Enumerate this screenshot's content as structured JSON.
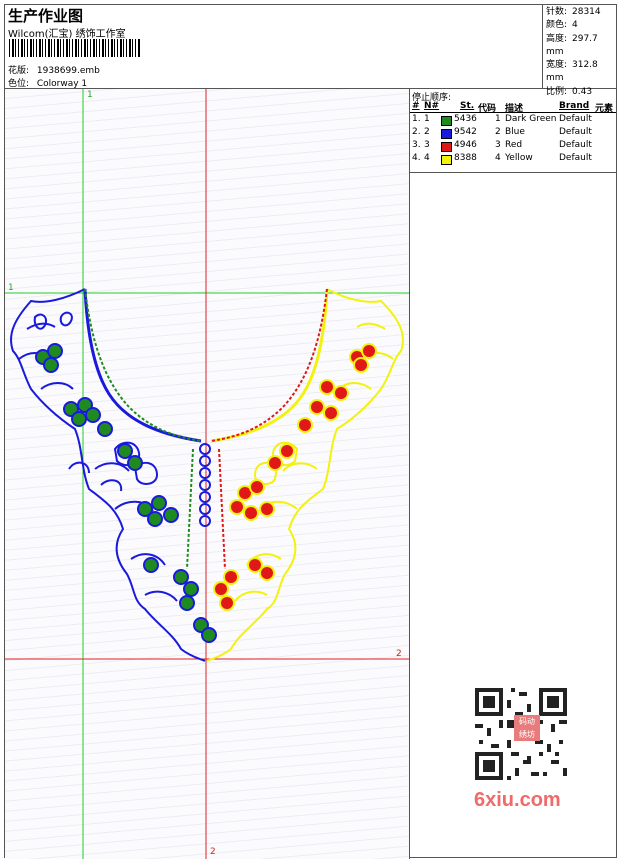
{
  "header": {
    "title": "生产作业图",
    "subtitle": "Wilcom(汇宝) 绣饰工作室",
    "design_label": "花版:",
    "design_value": "1938699.emb",
    "colorway_label": "色位:",
    "colorway_value": "Colorway 1"
  },
  "stats": [
    {
      "label": "针数:",
      "value": "28314"
    },
    {
      "label": "颜色:",
      "value": "4"
    },
    {
      "label": "高度:",
      "value": "297.7 mm"
    },
    {
      "label": "宽度:",
      "value": "312.8 mm"
    },
    {
      "label": "比例:",
      "value": "0.43"
    }
  ],
  "color_panel": {
    "title": "停止顺序:",
    "headers": [
      "#",
      "N#",
      "St.",
      "代码",
      "描述",
      "Brand",
      "元素"
    ],
    "rows": [
      {
        "num": "1.",
        "n": "1",
        "stitches": "5436",
        "code": "1",
        "desc": "Dark Green",
        "brand": "Default",
        "color": "#1f8a1f"
      },
      {
        "num": "2.",
        "n": "2",
        "stitches": "9542",
        "code": "2",
        "desc": "Blue",
        "brand": "Default",
        "color": "#1a1adc"
      },
      {
        "num": "3.",
        "n": "3",
        "stitches": "4946",
        "code": "3",
        "desc": "Red",
        "brand": "Default",
        "color": "#e01818"
      },
      {
        "num": "4.",
        "n": "4",
        "stitches": "8388",
        "code": "4",
        "desc": "Yellow",
        "brand": "Default",
        "color": "#f2f20e"
      }
    ]
  },
  "guides": {
    "v1_top": "1",
    "h1_left": "1",
    "h2_right": "2",
    "v2_bottom": "2"
  },
  "watermark": "6xiu.com",
  "stamp_text": "码动绣坊",
  "colors": {
    "green_guide": "#22cc22",
    "red_guide": "#dd2222",
    "green_thread": "#1f8a1f",
    "blue_thread": "#1a1adc",
    "red_thread": "#e01818",
    "yellow_thread": "#f2f20e"
  }
}
